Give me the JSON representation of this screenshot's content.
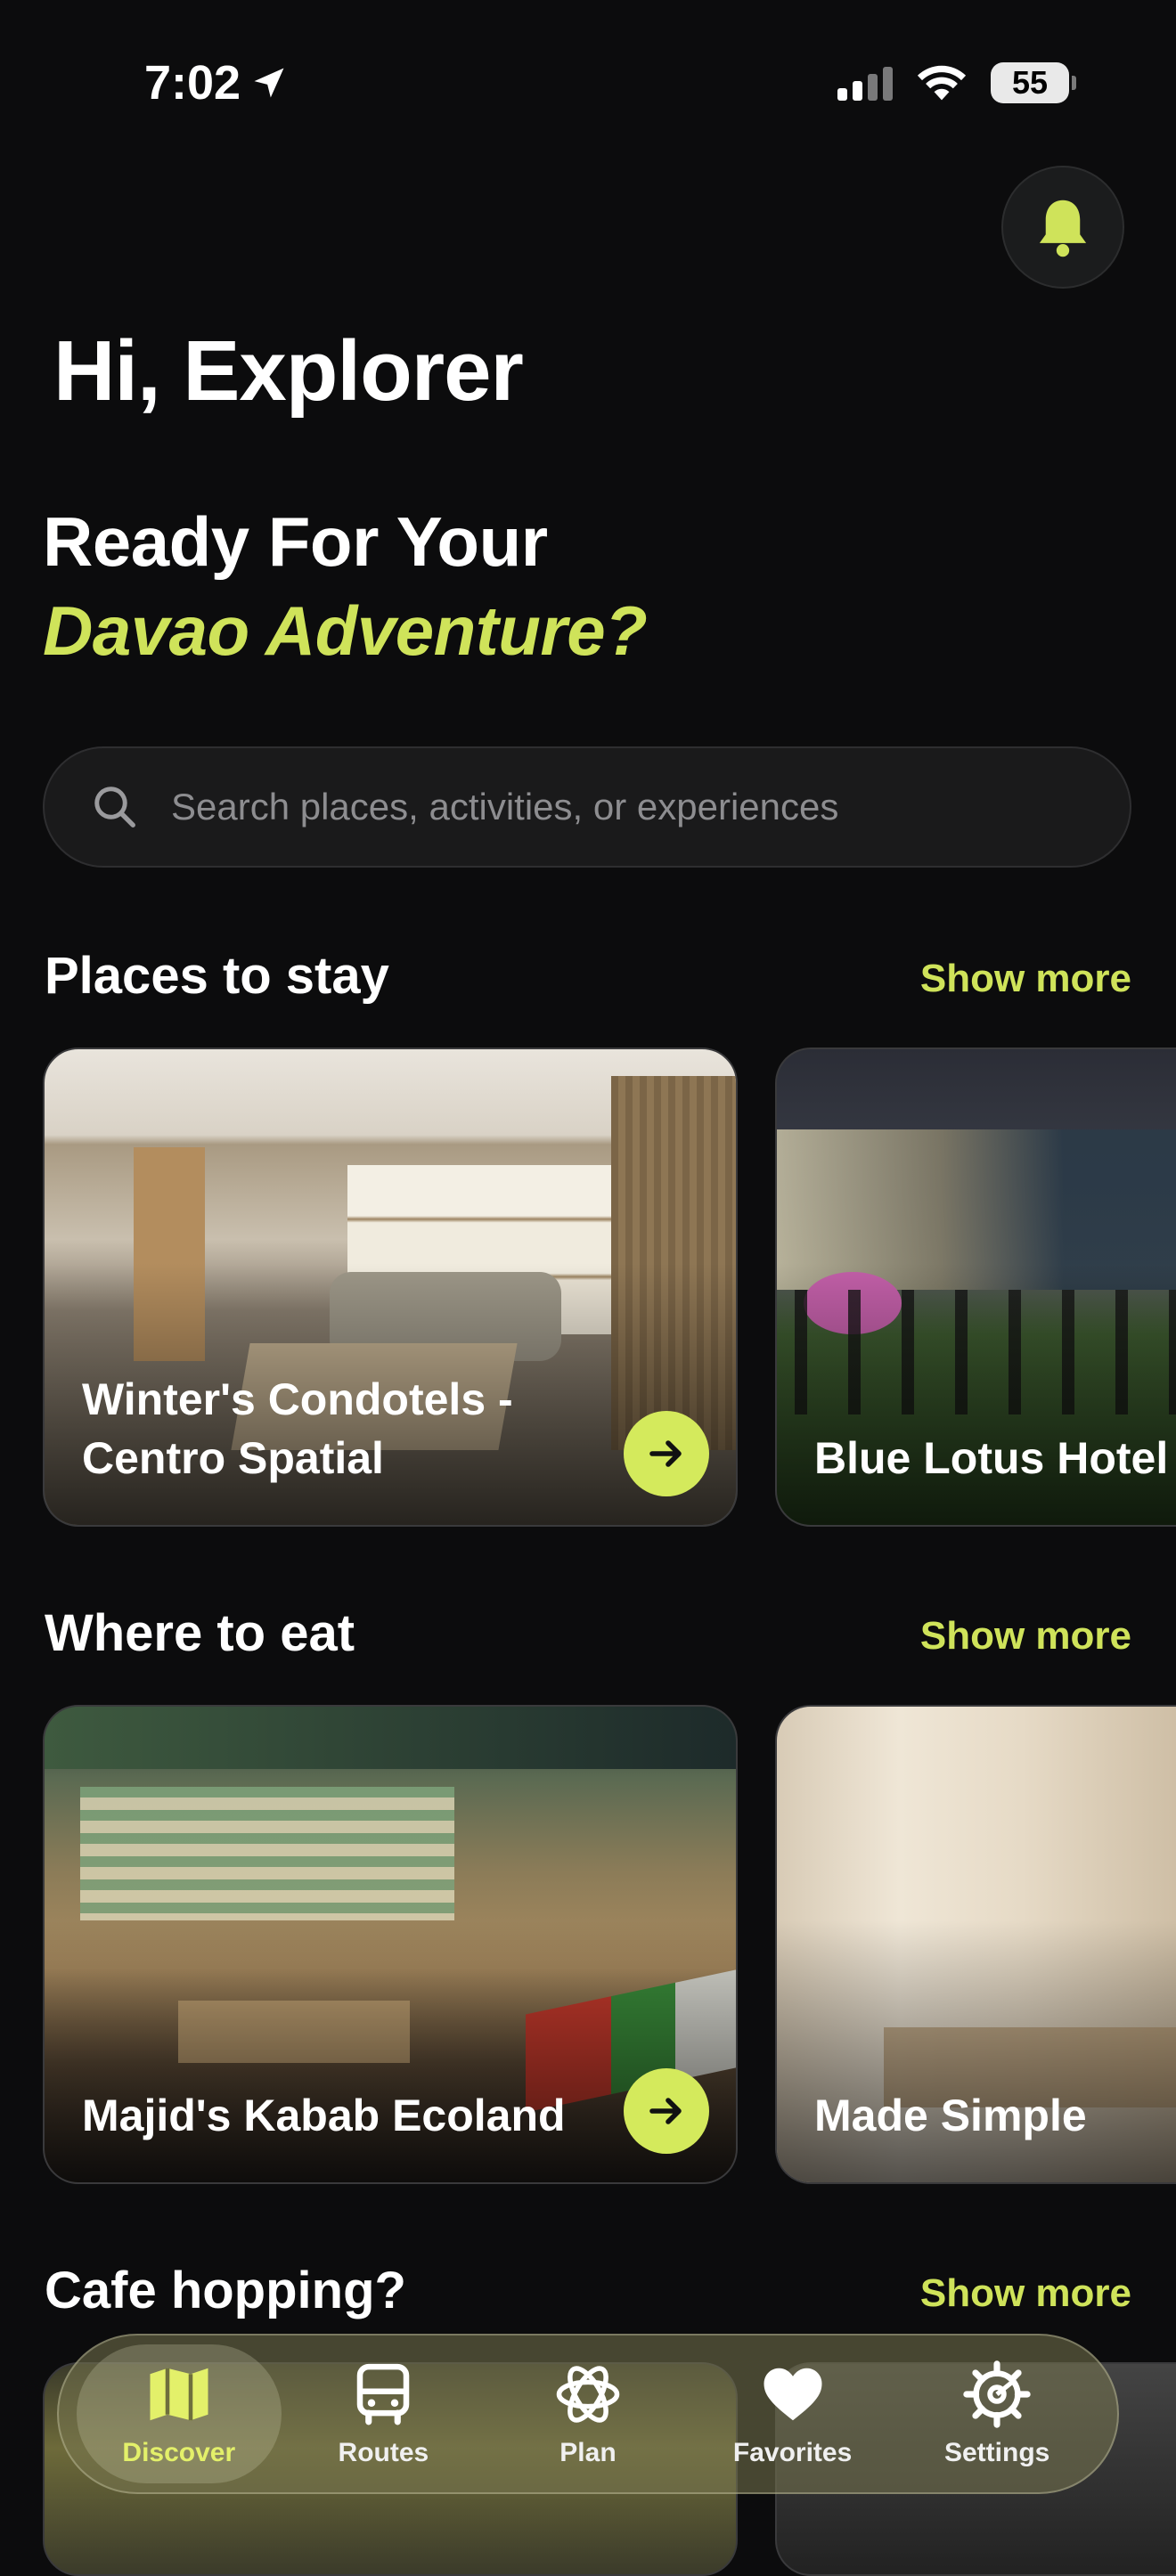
{
  "status": {
    "time": "7:02",
    "battery": "55"
  },
  "header": {
    "greeting": "Hi, Explorer",
    "headline_line1": "Ready For Your",
    "headline_line2": "Davao Adventure?"
  },
  "search": {
    "placeholder": "Search places, activities, or experiences"
  },
  "sections": [
    {
      "title": "Places to stay",
      "show_more": "Show more",
      "cards": [
        {
          "title": "Winter's Condotels - Centro Spatial"
        },
        {
          "title": "Blue Lotus Hotel"
        }
      ]
    },
    {
      "title": "Where to eat",
      "show_more": "Show more",
      "cards": [
        {
          "title": "Majid's Kabab Ecoland"
        },
        {
          "title": "Made Simple"
        }
      ]
    },
    {
      "title": "Cafe hopping?",
      "show_more": "Show more"
    }
  ],
  "tabbar": {
    "items": [
      {
        "label": "Discover",
        "icon": "map-icon",
        "active": true
      },
      {
        "label": "Routes",
        "icon": "bus-icon"
      },
      {
        "label": "Plan",
        "icon": "atom-icon"
      },
      {
        "label": "Favorites",
        "icon": "heart-icon"
      },
      {
        "label": "Settings",
        "icon": "gear-icon"
      }
    ]
  },
  "colors": {
    "accent": "#cfe35a",
    "background": "#0c0c0d"
  }
}
